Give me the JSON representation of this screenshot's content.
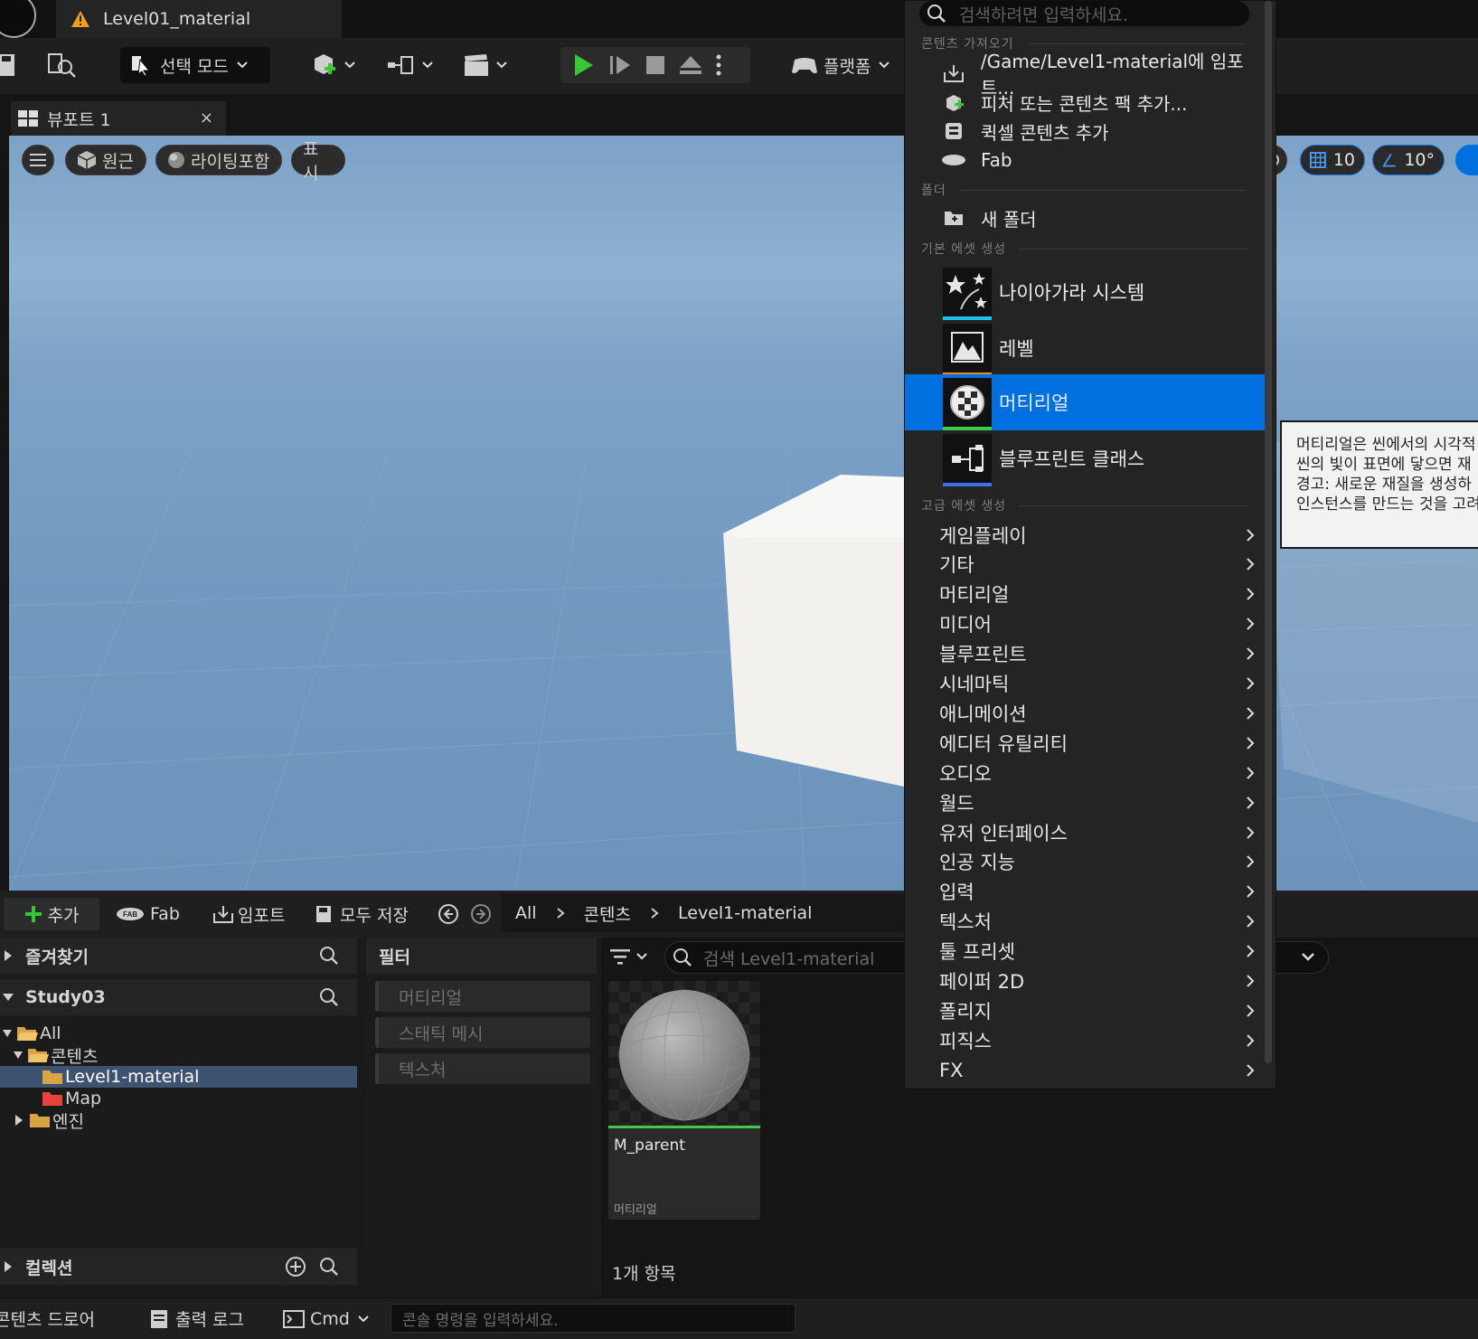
{
  "colors": {
    "accent": "#0070e0",
    "play_green": "#35c735",
    "niagara_bar": "#1ec0e8",
    "level_bar": "#f08a1c",
    "material_bar": "#41c94a",
    "blueprint_bar": "#3f6fe6",
    "map_folder": "#e8433a",
    "folder": "#d9a443",
    "warning": "#f0a020"
  },
  "window": {
    "doc_tab": "Level01_material"
  },
  "toolbar": {
    "mode_label": "선택 모드",
    "platform_label": "플랫폼"
  },
  "viewport": {
    "tab_label": "뷰포트 1",
    "close_glyph": "×",
    "perspective": "원근",
    "lighting": "라이팅포함",
    "show": "표시",
    "grid_snap": "10",
    "angle_snap": "10°"
  },
  "menu": {
    "search_placeholder": "검색하려면 입력하세요.",
    "sections": {
      "import": "콘텐츠 가져오기",
      "folder": "폴더",
      "basic": "기본 에셋 생성",
      "advanced": "고급 에셋 생성"
    },
    "import_items": [
      "/Game/Level1-material에 임포트...",
      "피처 또는 콘텐츠 팩 추가...",
      "퀵셀 콘텐츠 추가",
      "Fab"
    ],
    "new_folder": "새 폴더",
    "basic_items": [
      "나이아가라 시스템",
      "레벨",
      "머티리얼",
      "블루프린트 클래스"
    ],
    "advanced_items": [
      "게임플레이",
      "기타",
      "머티리얼",
      "미디어",
      "블루프린트",
      "시네마틱",
      "애니메이션",
      "에디터 유틸리티",
      "오디오",
      "월드",
      "유저 인터페이스",
      "인공 지능",
      "입력",
      "텍스처",
      "툴 프리셋",
      "페이퍼 2D",
      "폴리지",
      "피직스",
      "FX"
    ],
    "selected": "머티리얼"
  },
  "tooltip": {
    "lines": [
      "머티리얼은 씬에서의 시각적",
      "씬의 빛이 표면에 닿으면 재",
      "경고: 새로운 재질을 생성하",
      "인스턴스를 만드는 것을 고려"
    ]
  },
  "content_browser": {
    "add": "추가",
    "fab": "Fab",
    "import": "임포트",
    "save_all": "모두 저장",
    "breadcrumb": [
      "All",
      "콘텐츠",
      "Level1-material"
    ],
    "favorites": "즐겨찾기",
    "project": "Study03",
    "tree": [
      "All",
      "콘텐츠",
      "Level1-material",
      "Map",
      "엔진"
    ],
    "collections": "컬렉션",
    "filter_title": "필터",
    "filters": [
      "머티리얼",
      "스태틱 메시",
      "텍스처"
    ],
    "search_placeholder": "검색 Level1-material",
    "asset": {
      "name": "M_parent",
      "type": "머티리얼"
    },
    "item_count": "1개 항목"
  },
  "statusbar": {
    "content_drawer": "콘텐츠 드로어",
    "output_log": "출력 로그",
    "cmd": "Cmd",
    "console_placeholder": "콘솔 명령을 입력하세요."
  }
}
